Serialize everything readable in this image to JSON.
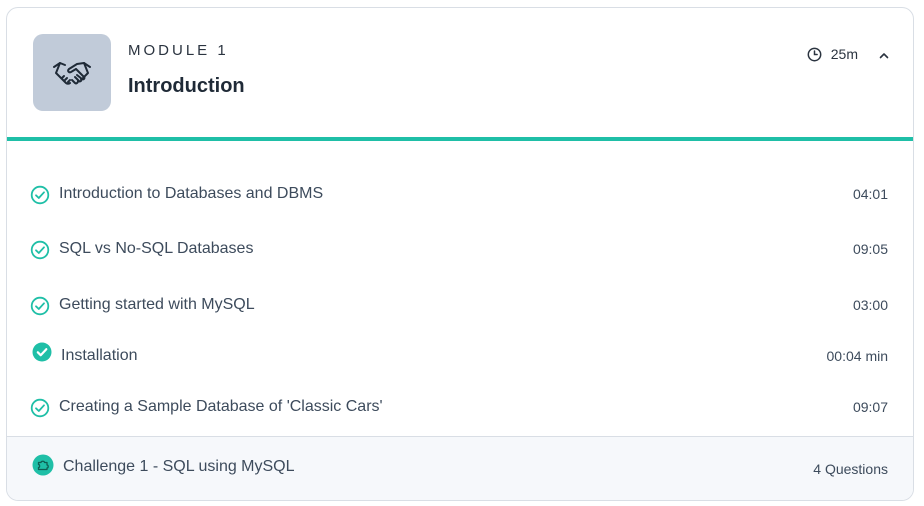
{
  "module": {
    "label": "MODULE 1",
    "title": "Introduction",
    "duration": "25m",
    "icon": "handshake-icon",
    "progress": 1.0,
    "colors": {
      "accent": "#1fbfa7",
      "icon_bg": "#c1cbd9"
    }
  },
  "lessons": [
    {
      "title": "Introduction to Databases and DBMS",
      "duration": "04:01",
      "status": "completed",
      "icon": "check-circle-outline-icon"
    },
    {
      "title": "SQL vs No-SQL Databases",
      "duration": "09:05",
      "status": "completed",
      "icon": "check-circle-outline-icon"
    },
    {
      "title": "Getting started with MySQL",
      "duration": "03:00",
      "status": "completed",
      "icon": "check-circle-outline-icon"
    },
    {
      "title": "Installation",
      "duration": "00:04 min",
      "status": "completed",
      "icon": "check-circle-filled-icon"
    },
    {
      "title": "Creating a Sample Database of 'Classic Cars'",
      "duration": "09:07",
      "status": "completed",
      "icon": "check-circle-outline-icon"
    }
  ],
  "challenge": {
    "title": "Challenge 1 - SQL using MySQL",
    "meta": "4 Questions",
    "icon": "puzzle-badge-icon"
  }
}
